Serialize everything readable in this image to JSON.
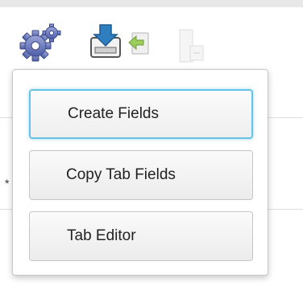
{
  "toolbar": {
    "icons": [
      "gear-icon",
      "save-icon",
      "import-icon",
      "export-icon"
    ]
  },
  "background": {
    "marker": "*"
  },
  "menu": {
    "items": [
      {
        "label": "Create Fields",
        "active": true
      },
      {
        "label": "Copy Tab Fields",
        "active": false
      },
      {
        "label": "Tab Editor",
        "active": false
      }
    ],
    "focus_color": "#66c3e8"
  }
}
